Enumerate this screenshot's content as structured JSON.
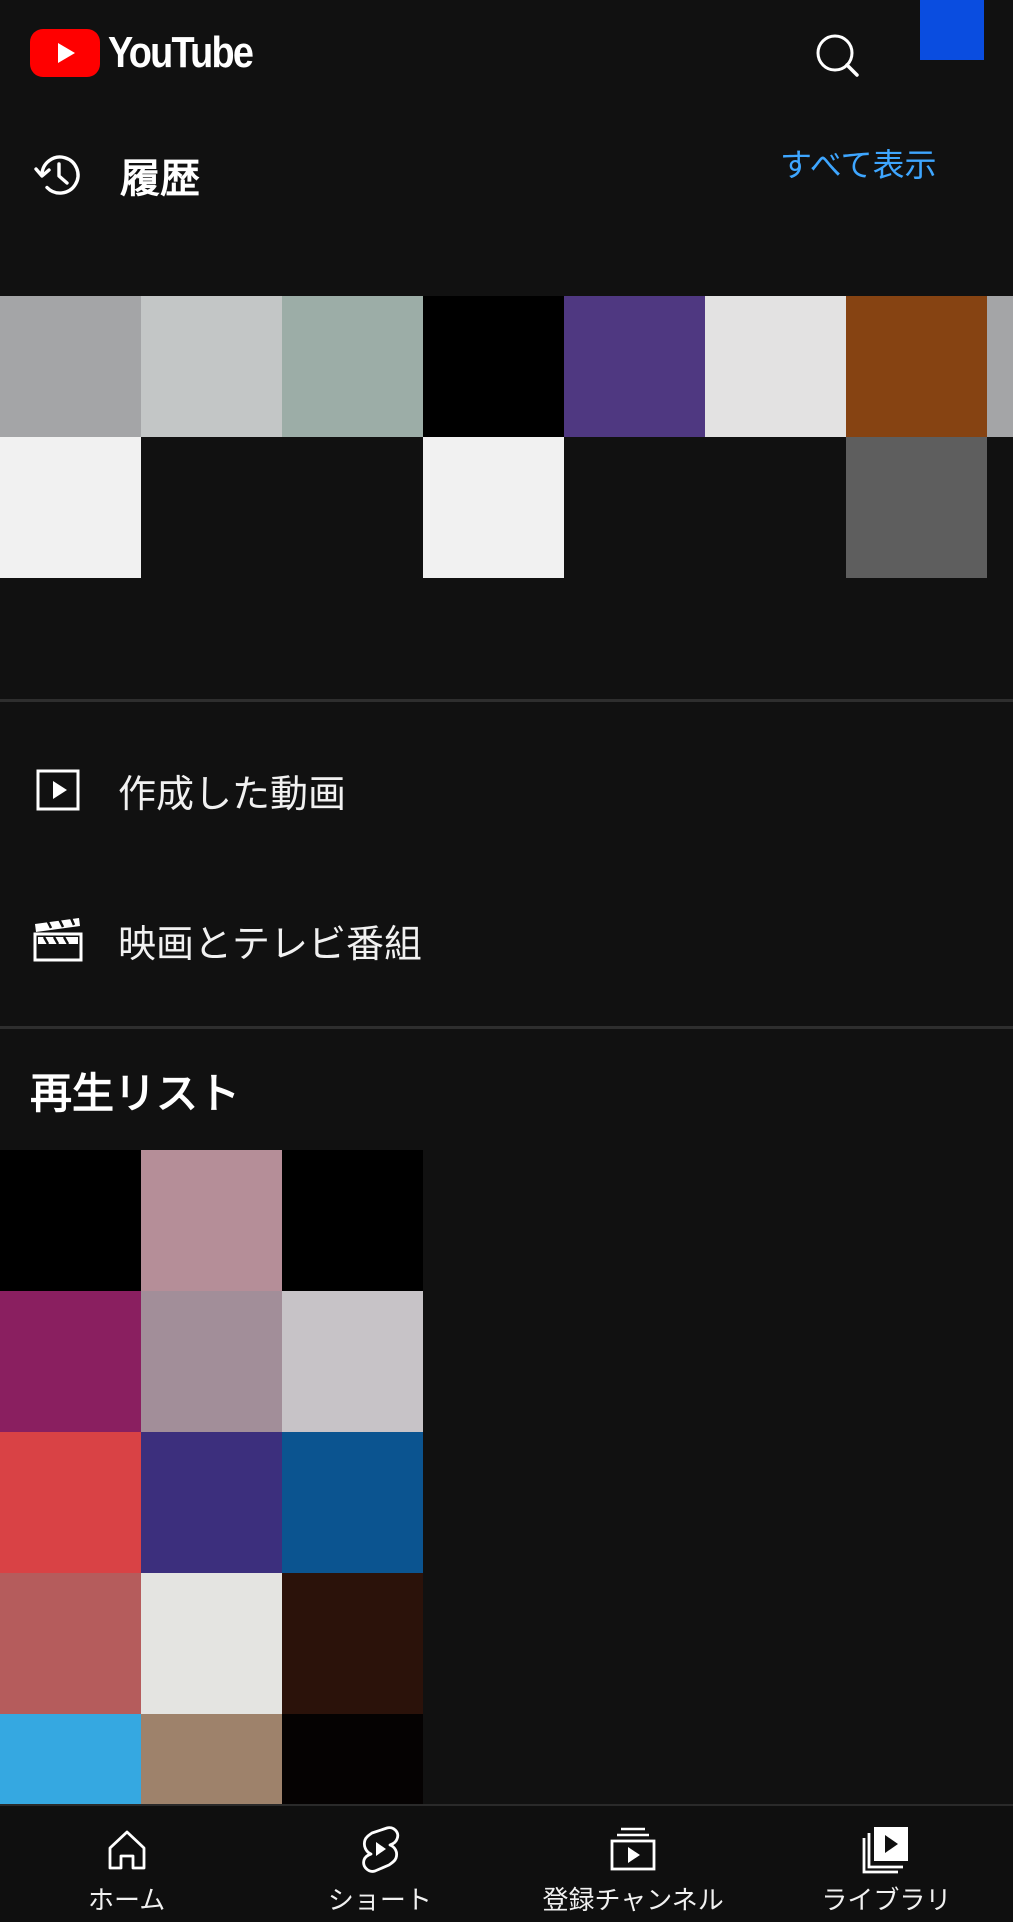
{
  "header": {
    "brand": "YouTube",
    "search_icon": "search-icon",
    "avatar_color": "#0a4de0"
  },
  "history": {
    "title": "履歴",
    "show_all": "すべて表示",
    "icon": "history-icon",
    "thumbnails": [
      {
        "row": 0,
        "col": 0,
        "color": "#a4a5a7"
      },
      {
        "row": 0,
        "col": 1,
        "color": "#c3c6c6"
      },
      {
        "row": 0,
        "col": 2,
        "color": "#9cada7"
      },
      {
        "row": 0,
        "col": 3,
        "color": "#000000"
      },
      {
        "row": 0,
        "col": 4,
        "color": "#4f3881"
      },
      {
        "row": 0,
        "col": 5,
        "color": "#e3e2e2"
      },
      {
        "row": 0,
        "col": 6,
        "color": "#864312"
      },
      {
        "row": 0,
        "col": 7,
        "color": "#a4a5a7"
      },
      {
        "row": 1,
        "col": 0,
        "color": "#f1f1f1"
      },
      {
        "row": 1,
        "col": 1,
        "color": "#111111"
      },
      {
        "row": 1,
        "col": 2,
        "color": "#111111"
      },
      {
        "row": 1,
        "col": 3,
        "color": "#f1f1f1"
      },
      {
        "row": 1,
        "col": 4,
        "color": "#111111"
      },
      {
        "row": 1,
        "col": 5,
        "color": "#111111"
      },
      {
        "row": 1,
        "col": 6,
        "color": "#5e5e5e"
      },
      {
        "row": 1,
        "col": 7,
        "color": "#111111"
      }
    ]
  },
  "menu": [
    {
      "label": "作成した動画",
      "icon": "play-square-icon"
    },
    {
      "label": "映画とテレビ番組",
      "icon": "clapperboard-icon"
    }
  ],
  "playlists": {
    "title": "再生リスト",
    "thumbnails": [
      {
        "row": 0,
        "col": 0,
        "color": "#000000"
      },
      {
        "row": 0,
        "col": 1,
        "color": "#b58e98"
      },
      {
        "row": 0,
        "col": 2,
        "color": "#000000"
      },
      {
        "row": 1,
        "col": 0,
        "color": "#8a1f60"
      },
      {
        "row": 1,
        "col": 1,
        "color": "#a28e99"
      },
      {
        "row": 1,
        "col": 2,
        "color": "#c7c3c7"
      },
      {
        "row": 2,
        "col": 0,
        "color": "#d94245"
      },
      {
        "row": 2,
        "col": 1,
        "color": "#3c2f7d"
      },
      {
        "row": 2,
        "col": 2,
        "color": "#0b5490"
      },
      {
        "row": 3,
        "col": 0,
        "color": "#b55c5c"
      },
      {
        "row": 3,
        "col": 1,
        "color": "#e4e4e1"
      },
      {
        "row": 3,
        "col": 2,
        "color": "#2b120a"
      },
      {
        "row": 4,
        "col": 0,
        "color": "#35a8e1"
      },
      {
        "row": 4,
        "col": 1,
        "color": "#9e826b"
      },
      {
        "row": 4,
        "col": 2,
        "color": "#050202"
      }
    ]
  },
  "bottom_nav": [
    {
      "label": "ホーム",
      "icon": "home-icon"
    },
    {
      "label": "ショート",
      "icon": "shorts-icon"
    },
    {
      "label": "登録チャンネル",
      "icon": "subscriptions-icon"
    },
    {
      "label": "ライブラリ",
      "icon": "library-icon"
    }
  ]
}
